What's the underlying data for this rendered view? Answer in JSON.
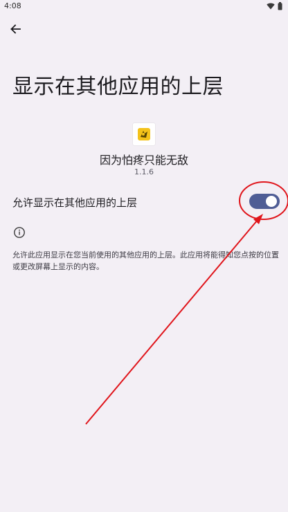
{
  "status_bar": {
    "time": "4:08",
    "icons": [
      "wifi-icon",
      "battery-icon"
    ]
  },
  "header": {
    "back_icon": "arrow-back-icon"
  },
  "page": {
    "title": "显示在其他应用的上层"
  },
  "app": {
    "icon": "app-icon",
    "name": "因为怕疼只能无敌",
    "version": "1.1.6"
  },
  "permission": {
    "label": "允许显示在其他应用的上层",
    "enabled": true,
    "info_icon": "info-icon",
    "description": "允许此应用显示在您当前使用的其他应用的上层。此应用将能得知您点按的位置或更改屏幕上显示的内容。"
  },
  "colors": {
    "background": "#f3eff5",
    "toggle_track": "#4f5d95",
    "toggle_thumb": "#ffffff",
    "annotation": "#e0151b"
  }
}
